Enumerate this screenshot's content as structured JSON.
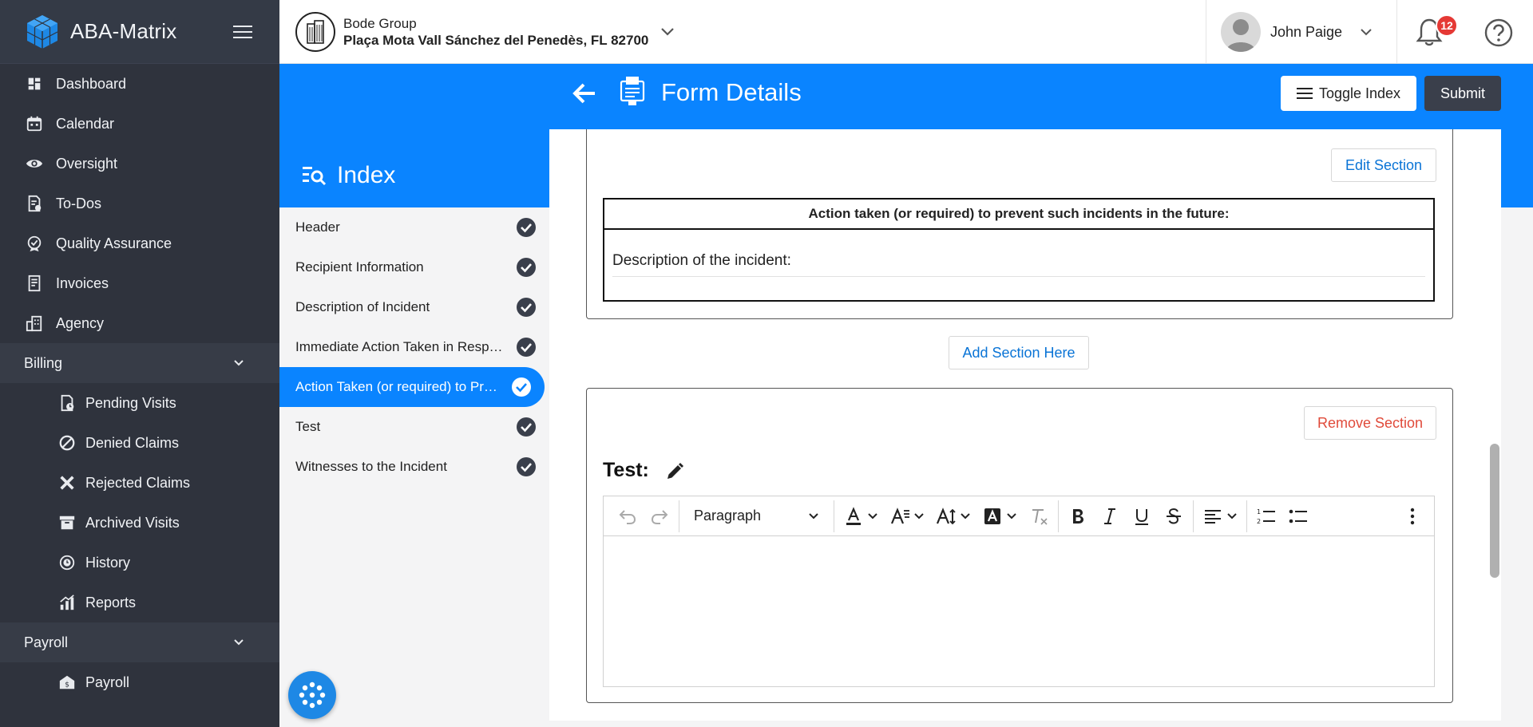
{
  "brand": {
    "name": "ABA-Matrix"
  },
  "nav": {
    "items": [
      {
        "label": "Dashboard",
        "icon": "dashboard-icon"
      },
      {
        "label": "Calendar",
        "icon": "calendar-icon"
      },
      {
        "label": "Oversight",
        "icon": "eye-icon"
      },
      {
        "label": "To-Dos",
        "icon": "todo-icon"
      },
      {
        "label": "Quality Assurance",
        "icon": "badge-check-icon"
      },
      {
        "label": "Invoices",
        "icon": "invoice-icon"
      },
      {
        "label": "Agency",
        "icon": "building-icon"
      }
    ],
    "billing": {
      "label": "Billing",
      "items": [
        {
          "label": "Pending Visits",
          "icon": "pending-icon"
        },
        {
          "label": "Denied Claims",
          "icon": "block-icon"
        },
        {
          "label": "Rejected Claims",
          "icon": "x-icon"
        },
        {
          "label": "Archived Visits",
          "icon": "archive-icon"
        },
        {
          "label": "History",
          "icon": "history-icon"
        },
        {
          "label": "Reports",
          "icon": "reports-icon"
        }
      ]
    },
    "payroll": {
      "label": "Payroll",
      "items": [
        {
          "label": "Payroll",
          "icon": "payroll-icon"
        }
      ]
    }
  },
  "header": {
    "company": "Bode Group",
    "address": "Plaça Mota Vall Sánchez del Penedès, FL 82700",
    "user": "John Paige",
    "notifications": "12"
  },
  "page": {
    "title": "Form Details",
    "toggle_index": "Toggle Index",
    "submit": "Submit"
  },
  "index": {
    "title": "Index",
    "items": [
      {
        "label": "Header",
        "active": false
      },
      {
        "label": "Recipient Information",
        "active": false
      },
      {
        "label": "Description of Incident",
        "active": false
      },
      {
        "label": "Immediate Action Taken in Response",
        "active": false
      },
      {
        "label": "Action Taken (or required) to Prevent",
        "active": true
      },
      {
        "label": "Test",
        "active": false
      },
      {
        "label": "Witnesses to the Incident",
        "active": false
      }
    ]
  },
  "section1": {
    "edit": "Edit Section",
    "table_header": "Action taken (or required) to prevent such incidents in the future:",
    "table_cell": "Description of the incident:"
  },
  "add_section": "Add Section Here",
  "section2": {
    "remove": "Remove Section",
    "title": "Test:",
    "toolbar": {
      "block_format": "Paragraph"
    }
  },
  "colors": {
    "primary": "#0a84ff",
    "sidebar": "#2f333d",
    "danger": "#e04a3a"
  }
}
